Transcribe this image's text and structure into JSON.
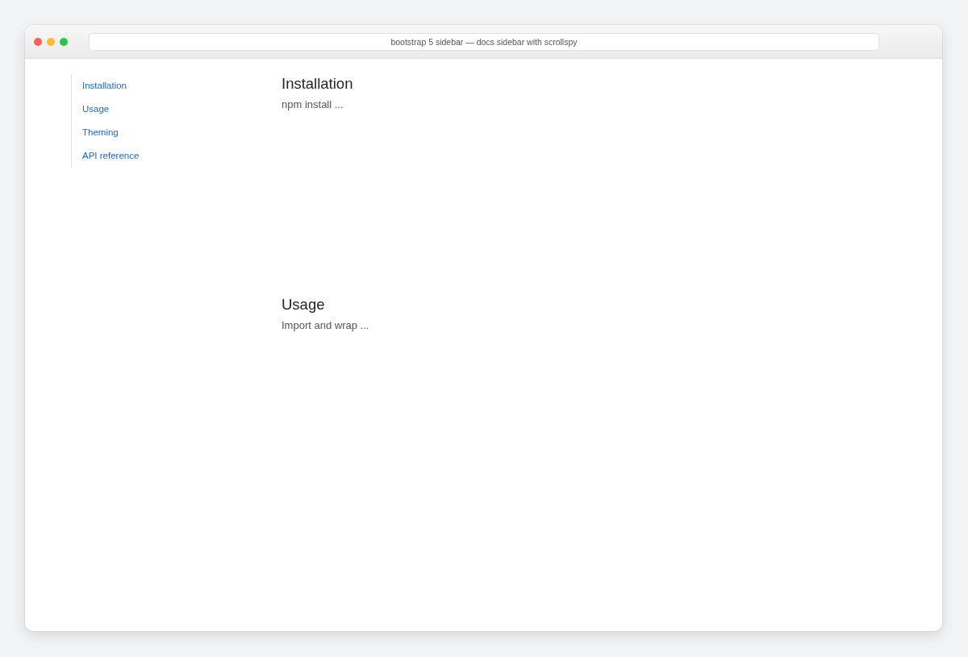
{
  "window": {
    "address_bar": "bootstrap 5 sidebar — docs sidebar with scrollspy"
  },
  "sidebar": {
    "items": [
      {
        "label": "Installation"
      },
      {
        "label": "Usage"
      },
      {
        "label": "Theming"
      },
      {
        "label": "API reference"
      }
    ]
  },
  "sections": [
    {
      "heading": "Installation",
      "text": "npm install ..."
    },
    {
      "heading": "Usage",
      "text": "Import and wrap ..."
    }
  ]
}
